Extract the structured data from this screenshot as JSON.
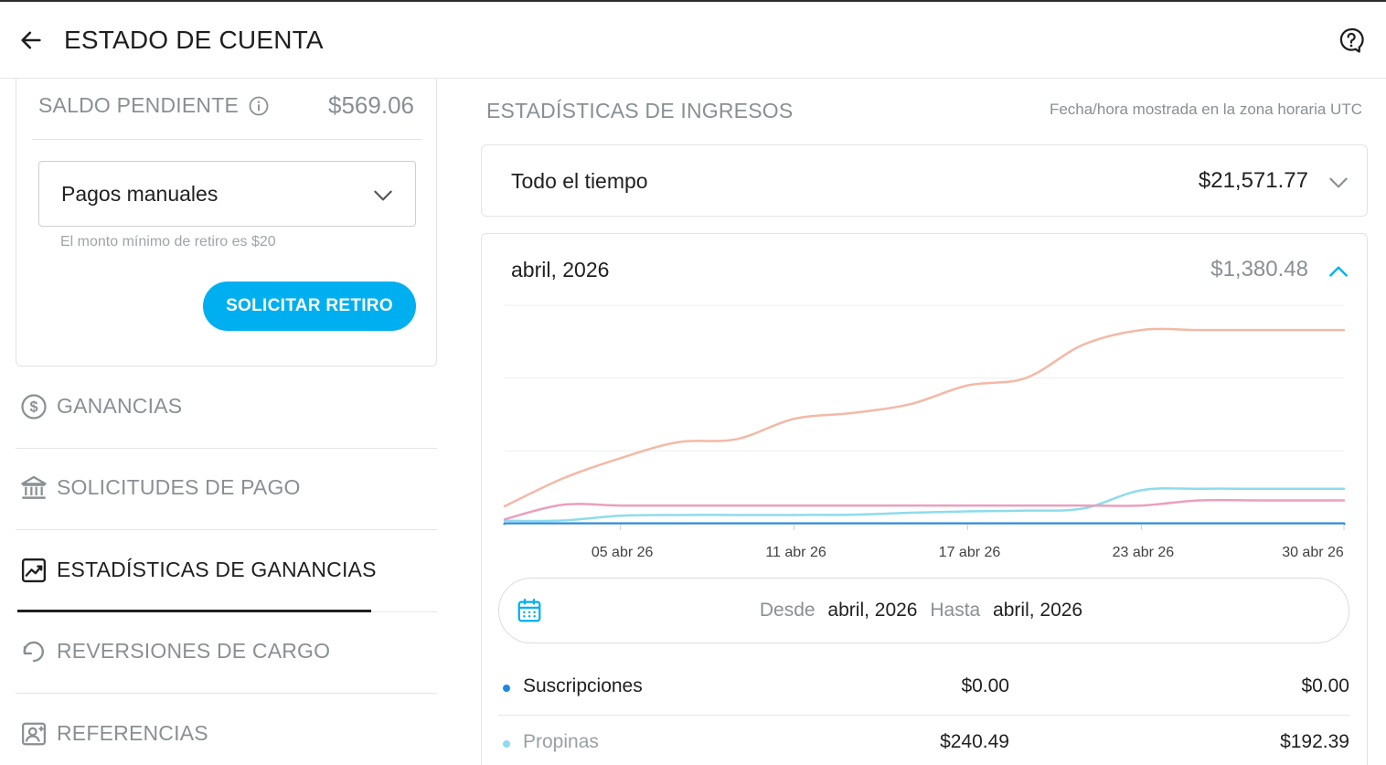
{
  "header": {
    "title": "ESTADO DE CUENTA",
    "back_icon": "arrow-left-icon",
    "help_icon": "help-circle-icon"
  },
  "balance": {
    "label": "SALDO PENDIENTE",
    "amount": "$569.06",
    "method_selected": "Pagos manuales",
    "min_note": "El monto mínimo de retiro es $20",
    "withdraw_button": "SOLICITAR RETIRO"
  },
  "nav": {
    "items": [
      {
        "label": "GANANCIAS",
        "icon": "dollar-circle-icon",
        "active": false
      },
      {
        "label": "SOLICITUDES DE PAGO",
        "icon": "bank-icon",
        "active": false
      },
      {
        "label": "ESTADÍSTICAS DE GANANCIAS",
        "icon": "chart-line-icon",
        "active": true
      },
      {
        "label": "REVERSIONES DE CARGO",
        "icon": "undo-icon",
        "active": false
      },
      {
        "label": "REFERENCIAS",
        "icon": "user-card-icon",
        "active": false
      }
    ]
  },
  "stats": {
    "title": "ESTADÍSTICAS DE INGRESOS",
    "tz_note": "Fecha/hora mostrada en la zona horaria UTC",
    "all_time_label": "Todo el tiempo",
    "all_time_value": "$21,571.77",
    "month_label": "abril, 2026",
    "month_value": "$1,380.48",
    "range_from_label": "Desde",
    "range_from": "abril, 2026",
    "range_to_label": "Hasta",
    "range_to": "abril, 2026",
    "rows": [
      {
        "name": "Suscripciones",
        "v1": "$0.00",
        "v2": "$0.00",
        "dot": "#1e88e5",
        "muted": false
      },
      {
        "name": "Propinas",
        "v1": "$240.49",
        "v2": "$192.39",
        "dot": "#8ddcec",
        "muted": true
      }
    ]
  },
  "colors": {
    "accent": "#00aff0",
    "series_total": "#f3b9a6",
    "series_tips": "#8ddcec",
    "series_pink": "#ea9fbe",
    "series_subs": "#1e88e5"
  },
  "chart_data": {
    "type": "line",
    "x_ticks": [
      "05 abr 26",
      "11 abr 26",
      "17 abr 26",
      "23 abr 26",
      "30 abr 26"
    ],
    "x": [
      1,
      3,
      5,
      7,
      9,
      11,
      13,
      15,
      17,
      19,
      21,
      23,
      25,
      27,
      29,
      30
    ],
    "ylim": [
      0,
      1500
    ],
    "grid": true,
    "legend": "none",
    "series": [
      {
        "color": "#f3b9a6",
        "values": [
          120,
          310,
          450,
          560,
          580,
          720,
          760,
          820,
          950,
          1000,
          1230,
          1330,
          1330,
          1330,
          1330,
          1330
        ]
      },
      {
        "color": "#8ddcec",
        "values": [
          20,
          22,
          55,
          60,
          60,
          60,
          62,
          75,
          85,
          90,
          105,
          230,
          240,
          240,
          240,
          240
        ]
      },
      {
        "color": "#ea9fbe",
        "values": [
          30,
          130,
          125,
          125,
          125,
          125,
          125,
          125,
          125,
          125,
          125,
          125,
          160,
          160,
          160,
          160
        ]
      },
      {
        "color": "#1e88e5",
        "values": [
          0,
          0,
          0,
          0,
          0,
          0,
          0,
          0,
          0,
          0,
          0,
          0,
          0,
          0,
          0,
          0
        ]
      }
    ]
  }
}
